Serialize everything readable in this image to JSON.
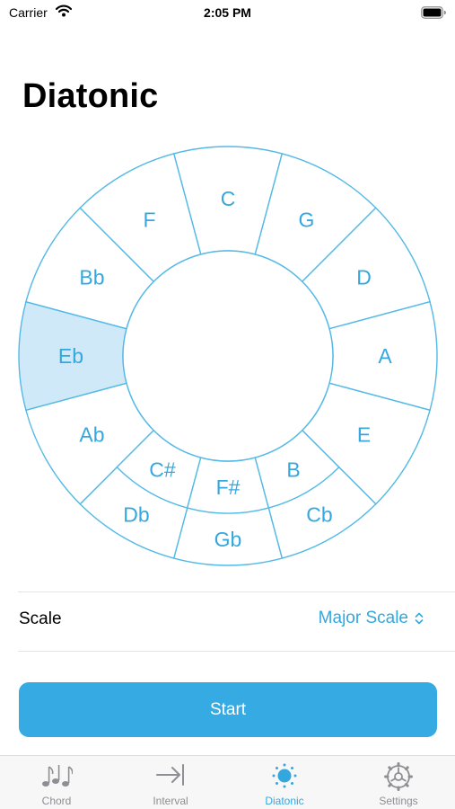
{
  "status_bar": {
    "carrier": "Carrier",
    "time": "2:05 PM"
  },
  "page": {
    "title": "Diatonic"
  },
  "wheel": {
    "selected_key": "Eb",
    "colors": {
      "line": "#53b9e6",
      "label": "#34a8de",
      "selected_fill": "#cfe9f8"
    },
    "outer_keys": [
      "C",
      "G",
      "D",
      "A",
      "E",
      "Cb",
      "Gb",
      "Db",
      "Ab",
      "Eb",
      "Bb",
      "F"
    ],
    "inner_keys": [
      "C#",
      "F#",
      "B"
    ]
  },
  "scale": {
    "label": "Scale",
    "value": "Major Scale"
  },
  "start_button": {
    "label": "Start"
  },
  "tabs": [
    {
      "label": "Chord",
      "icon": "music-notes-icon",
      "active": false
    },
    {
      "label": "Interval",
      "icon": "arrow-to-bar-icon",
      "active": false
    },
    {
      "label": "Diatonic",
      "icon": "sun-icon",
      "active": true
    },
    {
      "label": "Settings",
      "icon": "gear-icon",
      "active": false
    }
  ],
  "accent_color": "#35aae3"
}
